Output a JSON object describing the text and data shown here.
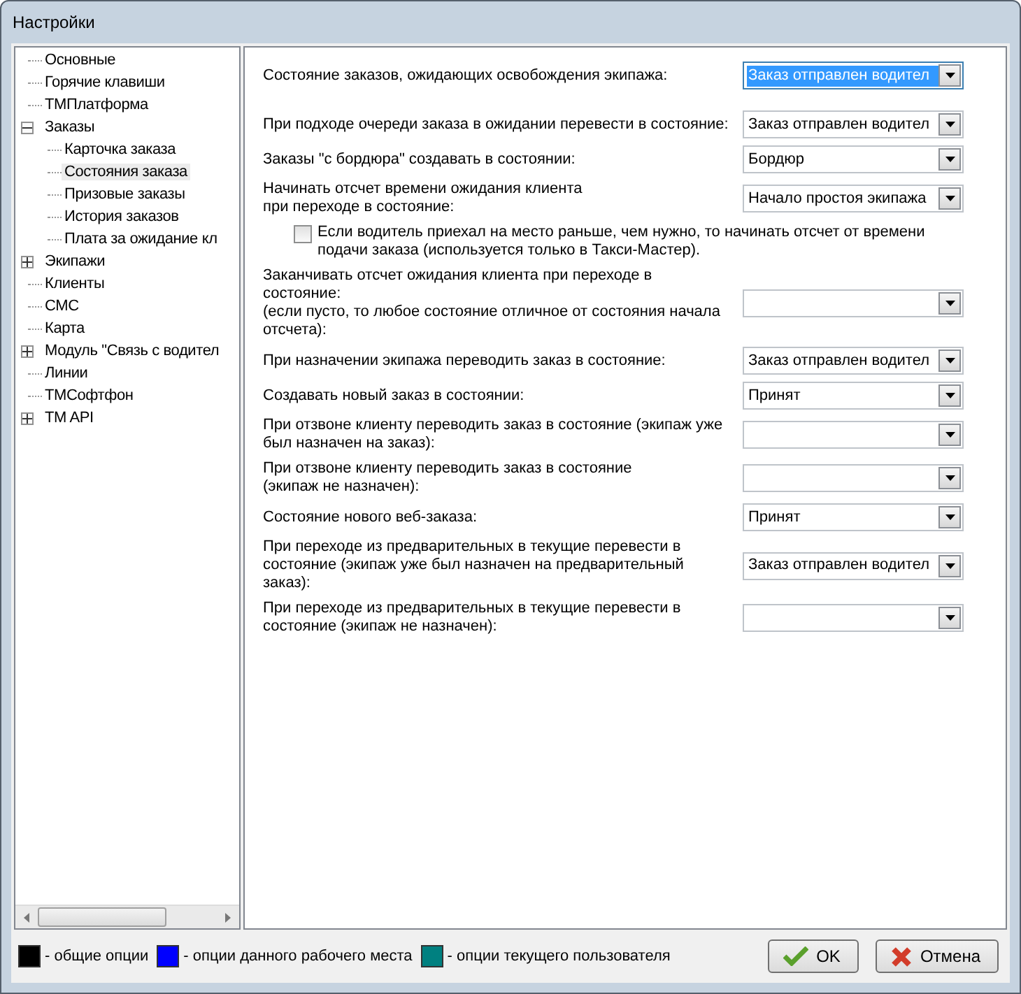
{
  "window": {
    "title": "Настройки"
  },
  "tree": [
    {
      "label": "Основные",
      "selected": false
    },
    {
      "label": "Горячие клавиши",
      "selected": false
    },
    {
      "label": "ТМПлатформа",
      "selected": false
    },
    {
      "label": "Заказы",
      "selected": false,
      "expanded": true,
      "children": [
        {
          "label": "Карточка заказа",
          "selected": false
        },
        {
          "label": "Состояния заказа",
          "selected": true
        },
        {
          "label": "Призовые заказы",
          "selected": false
        },
        {
          "label": "История заказов",
          "selected": false
        },
        {
          "label": "Плата за ожидание кл",
          "selected": false
        }
      ]
    },
    {
      "label": "Экипажи",
      "selected": false,
      "expanded": false
    },
    {
      "label": "Клиенты",
      "selected": false
    },
    {
      "label": "СМС",
      "selected": false
    },
    {
      "label": "Карта",
      "selected": false
    },
    {
      "label": "Модуль \"Связь с водител",
      "selected": false,
      "expanded": false
    },
    {
      "label": "Линии",
      "selected": false
    },
    {
      "label": "ТМСофтфон",
      "selected": false
    },
    {
      "label": "TM API",
      "selected": false,
      "expanded": false
    }
  ],
  "settings": [
    {
      "kind": "combo",
      "label": "Состояние заказов, ожидающих освобождения экипажа:",
      "value": "Заказ отправлен водител",
      "focused": true
    },
    {
      "kind": "combo",
      "label": "При подходе очереди заказа в ожидании перевести в состояние:",
      "value": "Заказ отправлен водител",
      "focused": false
    },
    {
      "kind": "combo",
      "label": "Заказы \"с бордюра\" создавать в состоянии:",
      "value": "Бордюр",
      "focused": false
    },
    {
      "kind": "combo",
      "label": "Начинать отсчет времени ожидания клиента\nпри переходе в состояние:",
      "value": "Начало простоя экипажа",
      "focused": false
    },
    {
      "kind": "checkbox",
      "label": "Если водитель приехал на место раньше, чем нужно, то начинать отсчет от времени подачи заказа (используется только в Такси-Мастер).",
      "checked": false
    },
    {
      "kind": "combo",
      "label": "Заканчивать отсчет ожидания клиента при переходе в состояние:\n(если пусто, то любое состояние отличное от состояния начала отсчета):",
      "focused": false
    },
    {
      "kind": "combo",
      "label": "При назначении экипажа переводить заказ в состояние:",
      "value": "Заказ отправлен водител",
      "focused": false
    },
    {
      "kind": "combo",
      "label": "Создавать новый заказ в состоянии:",
      "value": "Принят",
      "focused": false
    },
    {
      "kind": "combo",
      "label": "При отзвоне клиенту переводить заказ в состояние (экипаж уже был назначен на заказ):",
      "focused": false
    },
    {
      "kind": "combo",
      "label": "При отзвоне клиенту переводить заказ в состояние\n (экипаж не назначен):",
      "focused": false
    },
    {
      "kind": "combo",
      "label": "Состояние нового веб-заказа:",
      "value": "Принят",
      "focused": false
    },
    {
      "kind": "combo",
      "label": "При переходе из предварительных в текущие перевести в состояние (экипаж уже был назначен на предварительный заказ):",
      "value": "Заказ отправлен водител",
      "focused": false
    },
    {
      "kind": "combo",
      "label": "При переходе из предварительных в текущие перевести в состояние (экипаж не назначен):",
      "focused": false
    }
  ],
  "legend": [
    {
      "label": "- общие опции",
      "color": "#000000"
    },
    {
      "label": "- опции данного рабочего места",
      "color": "#0000ff"
    },
    {
      "label": "- опции текущего пользователя",
      "color": "#008080"
    }
  ],
  "buttons": [
    {
      "kind": "ok",
      "label": "OK"
    },
    {
      "kind": "cancel",
      "label": "Отмена"
    }
  ]
}
